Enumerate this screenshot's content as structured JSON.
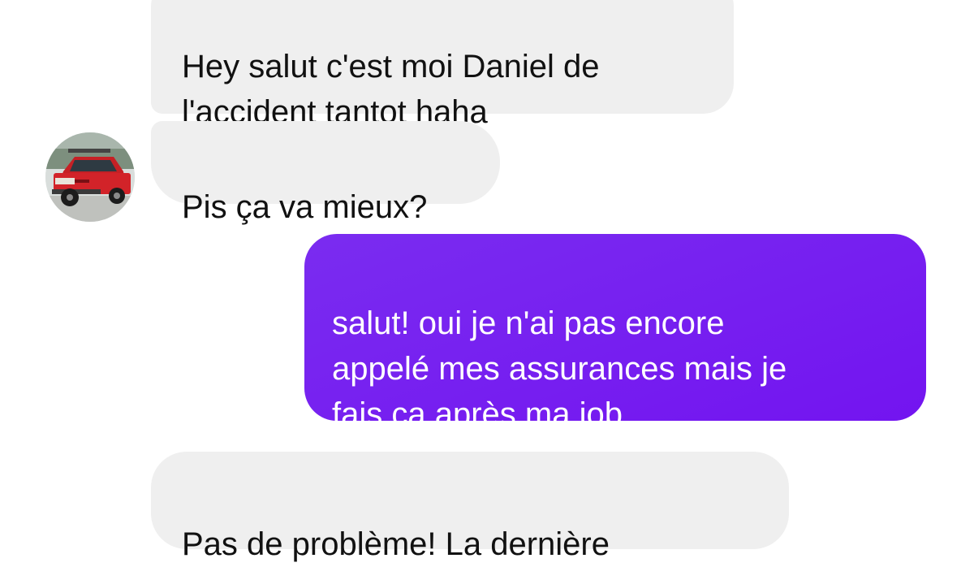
{
  "conversation": {
    "messages": [
      {
        "sender": "other",
        "text": "Hey salut c'est moi Daniel de\nl'accident tantot haha"
      },
      {
        "sender": "other",
        "text": "Pis ça va mieux?"
      },
      {
        "sender": "me",
        "text": "salut! oui je n'ai pas encore\nappelé mes assurances mais je\nfais ça après ma job"
      },
      {
        "sender": "other",
        "text": "Pas de problème! La dernière"
      }
    ],
    "avatar_icon": "contact-avatar-red-truck-photo"
  },
  "colors": {
    "incoming_bubble": "#efefef",
    "outgoing_bubble": "#7618f2",
    "incoming_text": "#111111",
    "outgoing_text": "#ffffff",
    "background": "#ffffff"
  }
}
